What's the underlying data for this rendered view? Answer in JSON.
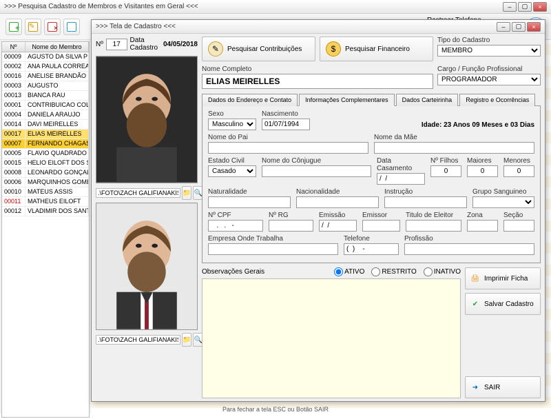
{
  "outer": {
    "title": ">>> Pesquisa Cadastro de Membros e Visitantes em Geral <<<",
    "track_label": "Rastrear Telefone"
  },
  "grid": {
    "col_num": "Nº",
    "col_name": "Nome do Membro",
    "rows": [
      {
        "num": "00009",
        "name": "AGUSTO DA SILVA P"
      },
      {
        "num": "00002",
        "name": "ANA PAULA CORREA"
      },
      {
        "num": "00016",
        "name": "ANELISE BRANDÃO"
      },
      {
        "num": "00003",
        "name": "AUGUSTO"
      },
      {
        "num": "00013",
        "name": "BIANCA RAU"
      },
      {
        "num": "00001",
        "name": "CONTRIBUICAO COLE"
      },
      {
        "num": "00004",
        "name": "DANIELA ARAUJO"
      },
      {
        "num": "00014",
        "name": "DAVI MEIRELLES"
      },
      {
        "num": "00017",
        "name": "ELIAS MEIRELLES",
        "sel": true
      },
      {
        "num": "00007",
        "name": "FERNANDO CHAGAS",
        "sel2": true
      },
      {
        "num": "00005",
        "name": "FLAVIO QUADRADO"
      },
      {
        "num": "00015",
        "name": "HELIO EILOFT DOS S"
      },
      {
        "num": "00008",
        "name": "LEONARDO GONÇAL"
      },
      {
        "num": "00006",
        "name": "MARQUINHOS GOME"
      },
      {
        "num": "00010",
        "name": "MATEUS ASSIS"
      },
      {
        "num": "00011",
        "name": "MATHEUS EILOFT",
        "red": true
      },
      {
        "num": "00012",
        "name": "VLADIMIR DOS SANT"
      }
    ]
  },
  "modal": {
    "title": ">>> Tela de Cadastro <<<",
    "num_label": "Nº",
    "num_value": "17",
    "date_label": "Data Cadastro",
    "date_value": "04/05/2018",
    "photo1_path": ".\\FOTO\\ZACH GALIFIANAKIS1.JPG",
    "photo2_path": ".\\FOTO\\ZACH GALIFIANAKIS2.JPG",
    "btn_contrib": "Pesquisar Contribuições",
    "btn_fin": "Pesquisar  Financeiro",
    "type_label": "Tipo do Cadastro",
    "type_value": "MEMBRO",
    "name_label": "Nome Completo",
    "name_value": "ELIAS MEIRELLES",
    "role_label": "Cargo / Função Profissional",
    "role_value": "PROGRAMADOR",
    "tabs": [
      "Dados do Endereço e Contato",
      "Informações Complementares",
      "Dados Carteirinha",
      "Registro e Ocorrências"
    ],
    "active_tab": 1,
    "sex_label": "Sexo",
    "sex_value": "Masculino",
    "birth_label": "Nascimento",
    "birth_value": "01/07/1994",
    "age_text": "Idade: 23 Anos 09 Meses e 03 Dias",
    "father_label": "Nome do Pai",
    "mother_label": "Nome da Mãe",
    "civil_label": "Estado Civil",
    "civil_value": "Casado",
    "spouse_label": "Nome do Cônjugue",
    "wed_label": "Data Casamento",
    "wed_value": "/  /",
    "kids_label": "Nº Filhos",
    "kids_value": "0",
    "adult_label": "Maiores",
    "adult_value": "0",
    "minor_label": "Menores",
    "minor_value": "0",
    "nat_label": "Naturalidade",
    "nac_label": "Nacionalidade",
    "edu_label": "Instrução",
    "blood_label": "Grupo Sanguineo",
    "cpf_label": "Nº CPF",
    "cpf_value": "   .   .   -",
    "rg_label": "Nº RG",
    "emis_label": "Emissão",
    "emis_value": "/  /",
    "emissor_label": "Emissor",
    "titulo_label": "Titulo de Eleitor",
    "zona_label": "Zona",
    "secao_label": "Seção",
    "work_label": "Empresa Onde Trabalha",
    "tel_label": "Telefone",
    "tel_value": "(  )    -",
    "prof_label": "Profissão",
    "obs_label": "Observações Gerais",
    "status_active": "ATIVO",
    "status_restrict": "RESTRITO",
    "status_inactive": "INATIVO",
    "btn_print": "Imprimir Ficha",
    "btn_save": "Salvar Cadastro",
    "btn_exit": "SAIR",
    "footer": "Para fechar a tela ESC ou Botão SAIR"
  }
}
